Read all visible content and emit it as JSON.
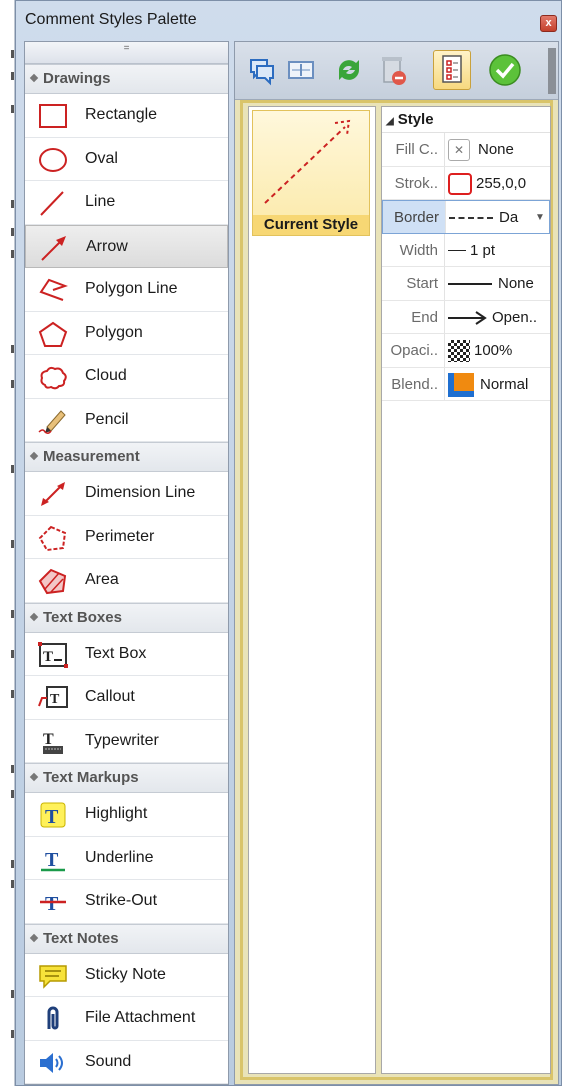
{
  "window": {
    "title": "Comment Styles Palette",
    "close": "x"
  },
  "palette": {
    "grip": "=",
    "categories": [
      {
        "label": "Drawings",
        "items": [
          "Rectangle",
          "Oval",
          "Line",
          "Arrow",
          "Polygon Line",
          "Polygon",
          "Cloud",
          "Pencil"
        ]
      },
      {
        "label": "Measurement",
        "items": [
          "Dimension Line",
          "Perimeter",
          "Area"
        ]
      },
      {
        "label": "Text Boxes",
        "items": [
          "Text Box",
          "Callout",
          "Typewriter"
        ]
      },
      {
        "label": "Text Markups",
        "items": [
          "Highlight",
          "Underline",
          "Strike-Out"
        ]
      },
      {
        "label": "Text Notes",
        "items": [
          "Sticky Note",
          "File Attachment",
          "Sound"
        ]
      }
    ],
    "selected_item": "Arrow"
  },
  "toolbar": {
    "icons": [
      "new-comment-icon",
      "edit-style-icon",
      "refresh-icon",
      "delete-icon",
      "show-properties-icon",
      "apply-icon"
    ]
  },
  "styles": {
    "current_label": "Current Style"
  },
  "properties": {
    "section": "Style",
    "rows": [
      {
        "name": "Fill C..",
        "value": "None"
      },
      {
        "name": "Strok..",
        "value": "255,0,0"
      },
      {
        "name": "Border",
        "value": "Da"
      },
      {
        "name": "Width",
        "value": "1 pt"
      },
      {
        "name": "Start",
        "value": "None"
      },
      {
        "name": "End",
        "value": "Open.."
      },
      {
        "name": "Opaci..",
        "value": "100%"
      },
      {
        "name": "Blend..",
        "value": "Normal"
      }
    ]
  },
  "colors": {
    "accent_red": "#cc2222",
    "selection": "#f7d774",
    "blend_orange": "#f08a10",
    "blend_blue": "#1f6fd0"
  }
}
